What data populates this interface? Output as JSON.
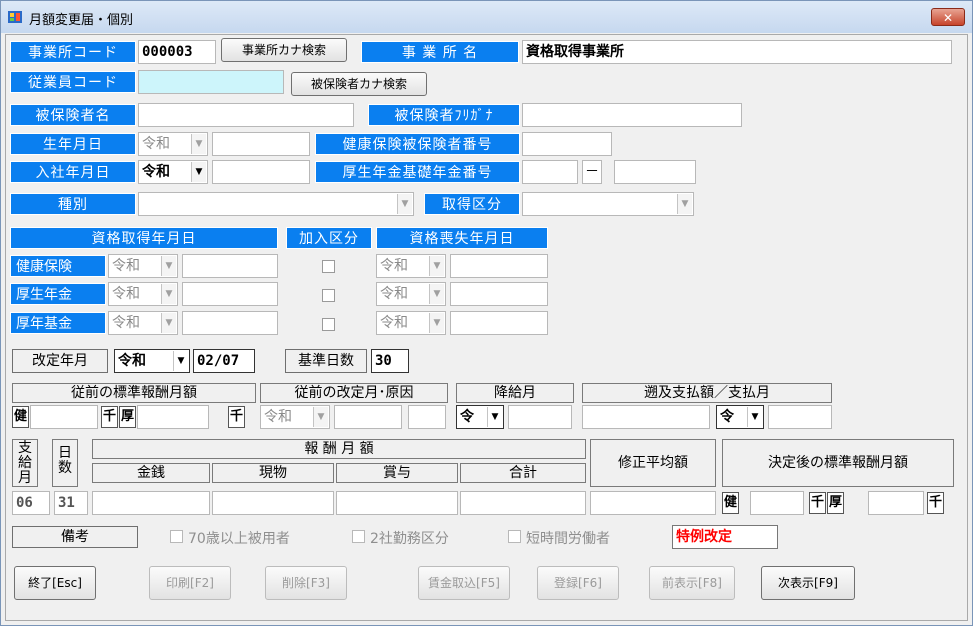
{
  "window": {
    "title": "月額変更届・個別",
    "close_glyph": "✕"
  },
  "office_code": {
    "label": "事業所コード",
    "value": "000003",
    "search_button": "事業所カナ検索"
  },
  "office_name": {
    "label": "事 業 所 名",
    "value": "資格取得事業所"
  },
  "employee_code": {
    "label": "従業員コード",
    "value": "",
    "search_button": "被保険者カナ検索"
  },
  "insured_name": {
    "label": "被保険者名",
    "value": ""
  },
  "insured_kana": {
    "label": "被保険者ﾌﾘｶﾞﾅ",
    "value": ""
  },
  "birth_date": {
    "label": "生年月日",
    "era": "令和",
    "value": ""
  },
  "health_ins_no": {
    "label": "健康保険被保険者番号",
    "value": ""
  },
  "hire_date": {
    "label": "入社年月日",
    "era": "令和",
    "value": ""
  },
  "pension_no": {
    "label": "厚生年金基礎年金番号",
    "value1": "",
    "dash": "－",
    "value2": ""
  },
  "category": {
    "label": "種別",
    "value": ""
  },
  "acquisition_type": {
    "label": "取得区分",
    "value": ""
  },
  "qualification": {
    "acq_header": "資格取得年月日",
    "join_header": "加入区分",
    "loss_header": "資格喪失年月日",
    "rows": [
      {
        "label": "健康保険",
        "acq_era": "令和",
        "acq_value": "",
        "loss_era": "令和",
        "loss_value": ""
      },
      {
        "label": "厚生年金",
        "acq_era": "令和",
        "acq_value": "",
        "loss_era": "令和",
        "loss_value": ""
      },
      {
        "label": "厚年基金",
        "acq_era": "令和",
        "acq_value": "",
        "loss_era": "令和",
        "loss_value": ""
      }
    ]
  },
  "revision_month": {
    "label": "改定年月",
    "era": "令和",
    "value": "02/07"
  },
  "base_days": {
    "label": "基準日数",
    "value": "30"
  },
  "prev_standard": {
    "label": "従前の標準報酬月額",
    "ken": "健",
    "sen": "千",
    "kou": "厚",
    "ken_value": "",
    "kou_value": ""
  },
  "prev_revision": {
    "label": "従前の改定月･原因",
    "era": "令和",
    "value": "",
    "cause": ""
  },
  "pay_drop": {
    "label": "降給月",
    "era": "令",
    "value": ""
  },
  "retro": {
    "label": "遡及支払額／支払月",
    "amount": "",
    "era": "令",
    "month": ""
  },
  "remuneration": {
    "pay_month_header": "支給月",
    "days_header": "日数",
    "monthly_header": "報 酬 月 額",
    "cash_header": "金銭",
    "kind_header": "現物",
    "bonus_header": "賞与",
    "total_header": "合計",
    "adjusted_header": "修正平均額",
    "decided_header": "決定後の標準報酬月額",
    "row": {
      "month": "06",
      "days": "31",
      "cash": "",
      "kind": "",
      "bonus": "",
      "total": "",
      "adjusted": ""
    },
    "decided": {
      "ken": "健",
      "sen": "千",
      "kou": "厚",
      "ken_value": "",
      "kou_value": ""
    }
  },
  "remarks": {
    "label": "備考",
    "over70": "70歳以上被用者",
    "two_offices": "2社勤務区分",
    "short_time": "短時間労働者",
    "special": "特例改定"
  },
  "buttons": {
    "exit": "終了[Esc]",
    "print": "印刷[F2]",
    "delete": "削除[F3]",
    "import": "賃金取込[F5]",
    "register": "登録[F6]",
    "prev": "前表示[F8]",
    "next": "次表示[F9]"
  }
}
